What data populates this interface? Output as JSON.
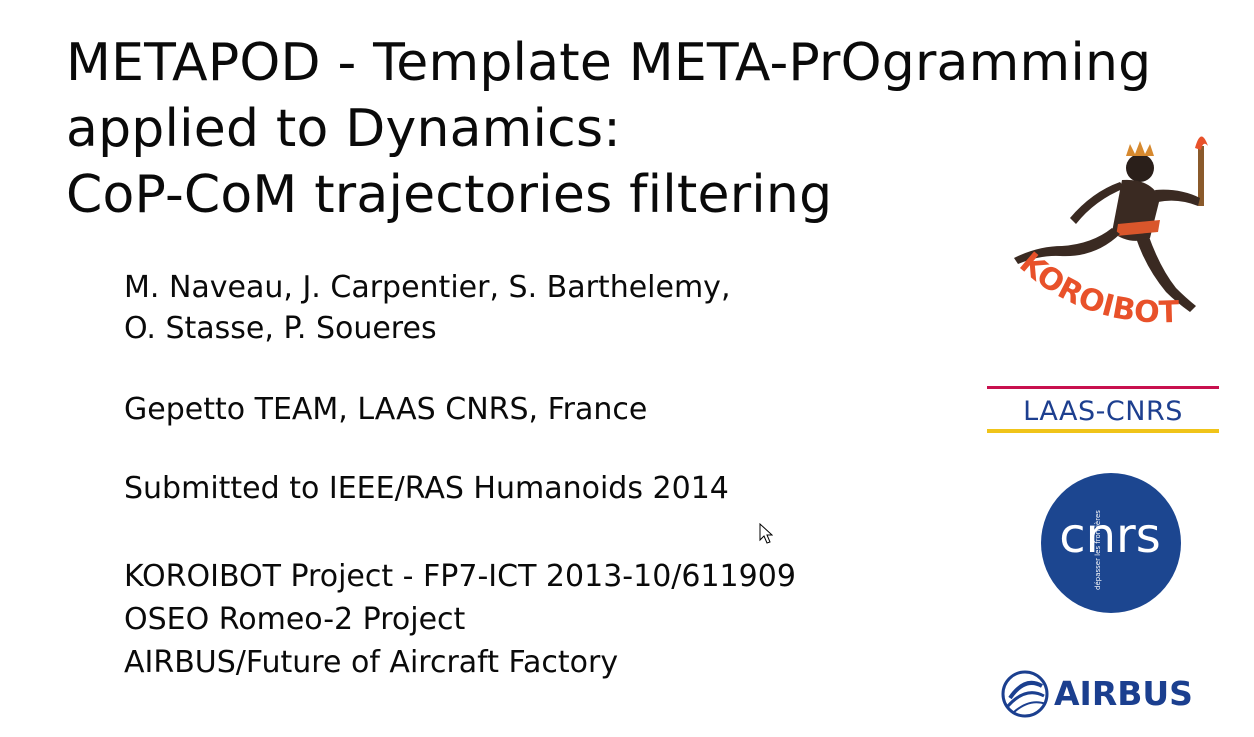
{
  "slide": {
    "title_lines": [
      "METAPOD - Template META-PrOgramming",
      "applied to Dynamics:",
      "CoP-CoM trajectories filtering"
    ],
    "authors_lines": [
      "M. Naveau, J. Carpentier, S. Barthelemy,",
      "O. Stasse, P. Soueres"
    ],
    "affiliation": "Gepetto TEAM, LAAS CNRS, France",
    "submitted": "Submitted to IEEE/RAS Humanoids 2014",
    "projects": [
      "KOROIBOT Project - FP7-ICT 2013-10/611909",
      "OSEO Romeo-2 Project",
      "AIRBUS/Future of Aircraft Factory"
    ]
  },
  "logos": {
    "koroibot": {
      "text": "KOROIBOT",
      "color": "#e8512a"
    },
    "laas": {
      "text": "LAAS-CNRS",
      "top_bar_color": "#c8104e",
      "bottom_bar_color": "#f0c419",
      "text_color": "#1d3f8f"
    },
    "cnrs": {
      "text": "cnrs",
      "subtext": "dépasser les frontières",
      "bg_color": "#1c4690"
    },
    "airbus": {
      "text": "AIRBUS",
      "color": "#1b3f8f"
    }
  },
  "icons": {
    "cursor": "mouse-pointer-icon"
  }
}
